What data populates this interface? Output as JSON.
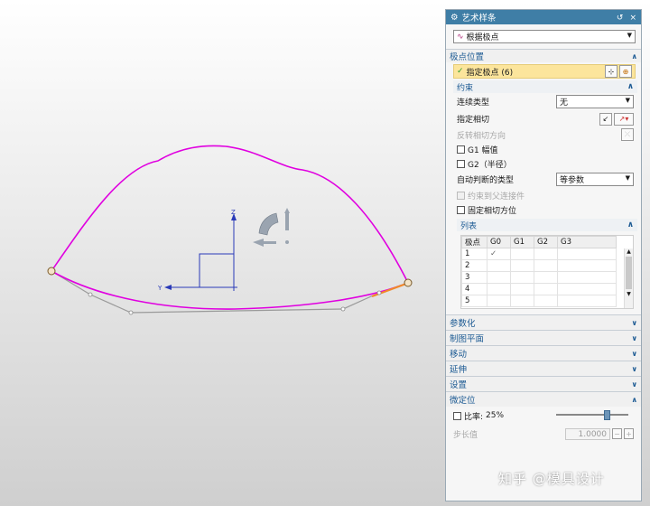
{
  "panel": {
    "title": "艺术样条",
    "title_buttons": [
      "↺",
      "×"
    ],
    "type_combo": {
      "icon": "spline-icon",
      "value": "根据极点"
    },
    "pole_section": {
      "title": "极点位置",
      "specify_poles": "指定极点 (6)"
    },
    "constraint": {
      "title": "约束",
      "continuity_label": "连续类型",
      "continuity_value": "无",
      "tangent_label": "指定相切",
      "reverse_label": "反转相切方向",
      "g1_label": "G1 幅值",
      "g2_label": "G2（半径）",
      "auto_type_label": "自动判断的类型",
      "auto_type_value": "等参数",
      "parent_label": "约束到父连接件",
      "fix_tangent_label": "固定相切方位"
    },
    "list": {
      "title": "列表",
      "headers": [
        "极点",
        "G0",
        "G1",
        "G2",
        "G3"
      ],
      "rows": [
        [
          "1",
          "✓",
          "",
          "",
          ""
        ],
        [
          "2",
          "",
          "",
          "",
          ""
        ],
        [
          "3",
          "",
          "",
          "",
          ""
        ],
        [
          "4",
          "",
          "",
          "",
          ""
        ],
        [
          "5",
          "",
          "",
          "",
          ""
        ]
      ]
    },
    "collapsed_sections": [
      "参数化",
      "制图平面",
      "移动",
      "延伸",
      "设置"
    ],
    "micro": {
      "title": "微定位",
      "ratio_label": "比率:",
      "ratio_value": "25%",
      "ratio_fraction": 0.25,
      "step_label": "步长值",
      "step_value": "1.0000"
    }
  },
  "watermark": "知乎 @模具设计",
  "axes": {
    "z": "Z",
    "y": "Y"
  },
  "colors": {
    "titlebar": "#3f7ea6",
    "curve": "#e000e0",
    "highlight": "#fce59c",
    "axis": "#2a3ab8"
  }
}
